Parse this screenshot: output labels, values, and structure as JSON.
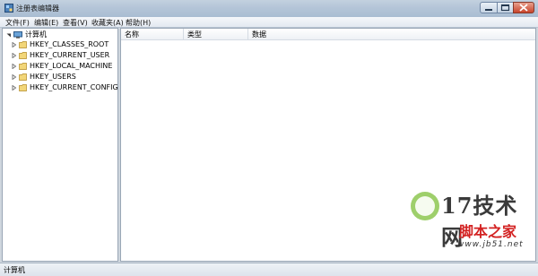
{
  "window": {
    "title": "注册表编辑器"
  },
  "menu": [
    "文件(F)",
    "编辑(E)",
    "查看(V)",
    "收藏夹(A)",
    "帮助(H)"
  ],
  "tree": {
    "root": "计算机",
    "items": [
      "HKEY_CLASSES_ROOT",
      "HKEY_CURRENT_USER",
      "HKEY_LOCAL_MACHINE",
      "HKEY_USERS",
      "HKEY_CURRENT_CONFIG"
    ]
  },
  "list": {
    "columns": [
      "名称",
      "类型",
      "数据"
    ]
  },
  "status": {
    "text": "计算机"
  },
  "watermark": {
    "brand": "17技术网",
    "sub": "脚本之家",
    "url": "www.jb51.net"
  },
  "colors": {
    "titlebar": "#b4c5d8",
    "close": "#c8442b",
    "folder": "#e8c25a",
    "watermark_red": "#d32222"
  }
}
